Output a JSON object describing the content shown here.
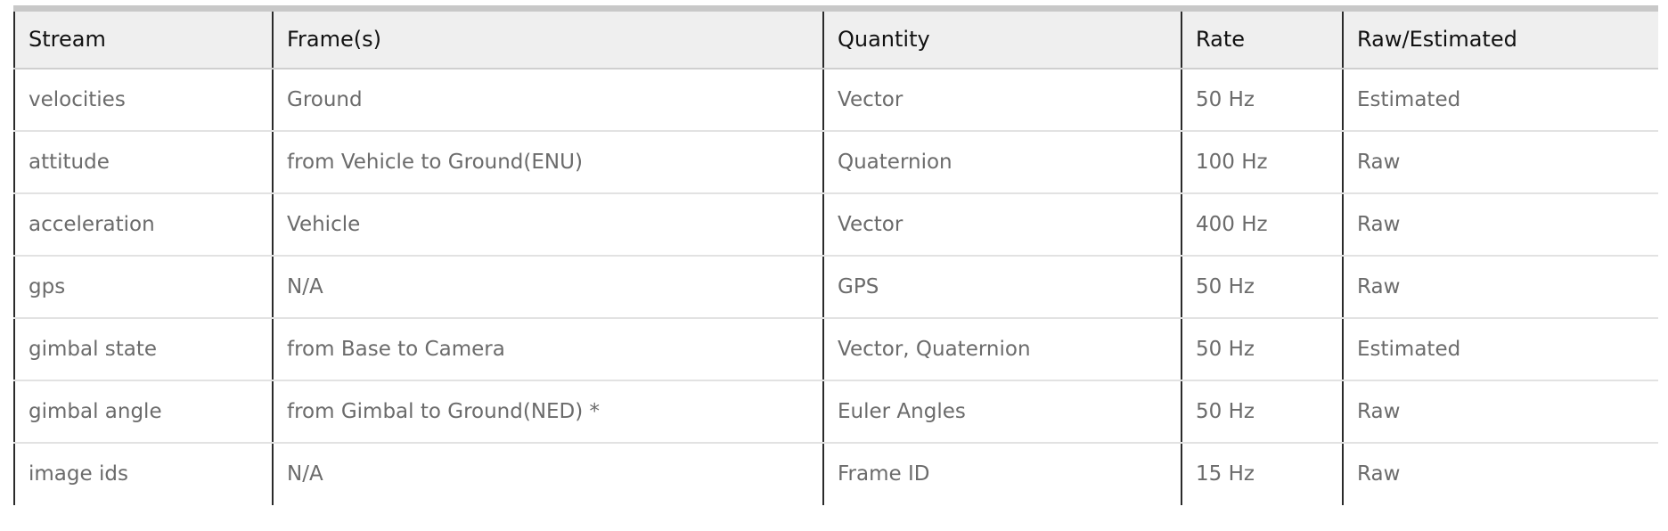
{
  "table": {
    "headers": [
      "Stream",
      "Frame(s)",
      "Quantity",
      "Rate",
      "Raw/Estimated"
    ],
    "rows": [
      [
        "velocities",
        "Ground",
        "Vector",
        "50 Hz",
        "Estimated"
      ],
      [
        "attitude",
        "from Vehicle to Ground(ENU)",
        "Quaternion",
        "100 Hz",
        "Raw"
      ],
      [
        "acceleration",
        "Vehicle",
        "Vector",
        "400 Hz",
        "Raw"
      ],
      [
        "gps",
        "N/A",
        "GPS",
        "50 Hz",
        "Raw"
      ],
      [
        "gimbal state",
        "from Base to Camera",
        "Vector, Quaternion",
        "50 Hz",
        "Estimated"
      ],
      [
        "gimbal angle",
        "from Gimbal to Ground(NED) *",
        "Euler Angles",
        "50 Hz",
        "Raw"
      ],
      [
        "image ids",
        "N/A",
        "Frame ID",
        "15 Hz",
        "Raw"
      ]
    ]
  }
}
